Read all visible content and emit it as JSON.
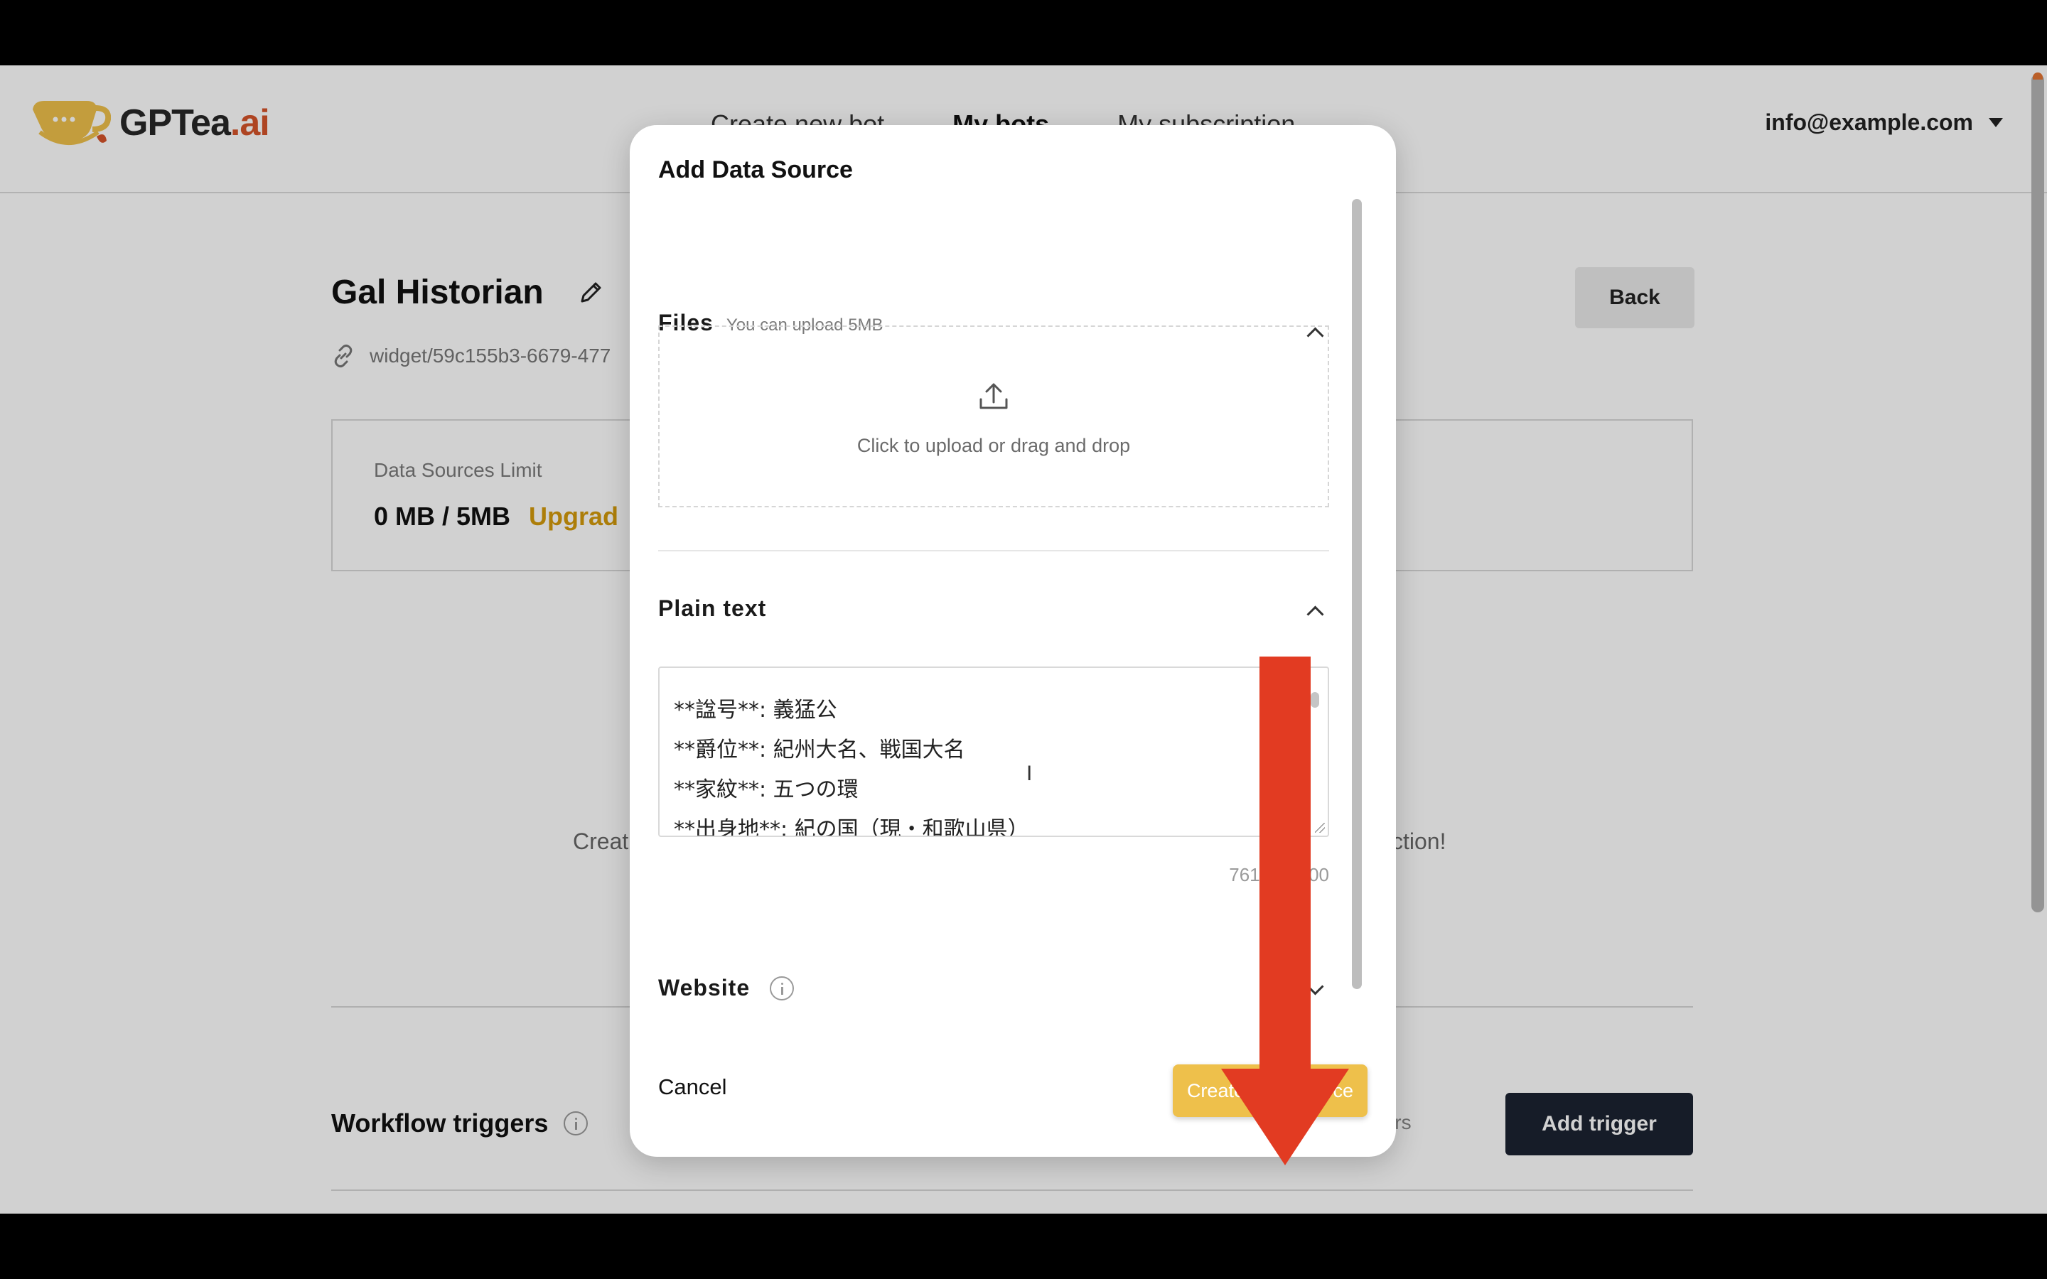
{
  "app": {
    "brand": {
      "main": "GPTea",
      "suffix": ".ai"
    },
    "nav": [
      "Create new bot",
      "My bots",
      "My subscription"
    ],
    "nav_active": "My bots",
    "account_email": "info@example.com"
  },
  "page": {
    "bot_name": "Gal Historian",
    "widget_path": "widget/59c155b3-6679-477",
    "back_label": "Back",
    "limit_label": "Data Sources Limit",
    "limit_value": "0 MB / 5MB",
    "upgrade_label": "Upgrad",
    "empty_message_left": "Creat",
    "empty_message_right": "ction!",
    "workflow_title": "Workflow triggers",
    "no_triggers_text": "riggers",
    "add_trigger_label": "Add trigger"
  },
  "modal": {
    "title": "Add Data Source",
    "files": {
      "title": "Files",
      "note": "You can upload 5MB",
      "upload_text": "Click to upload or drag and drop"
    },
    "plain_text": {
      "title": "Plain text",
      "lines": [
        "**諡号**: 義猛公",
        "**爵位**: 紀州大名、戦国大名",
        "**家紋**: 五つの環",
        "**出身地**: 紀の国（現・和歌山県）"
      ],
      "char_count": "761 /",
      "char_count_tail": "00"
    },
    "website": {
      "title": "Website"
    },
    "cancel_label": "Cancel",
    "create_label": "Create Data source"
  },
  "colors": {
    "accent_yellow": "#eec04b",
    "brand_orange": "#d5542a",
    "arrow_red": "#e23b22",
    "dark_button": "#1c2331"
  }
}
